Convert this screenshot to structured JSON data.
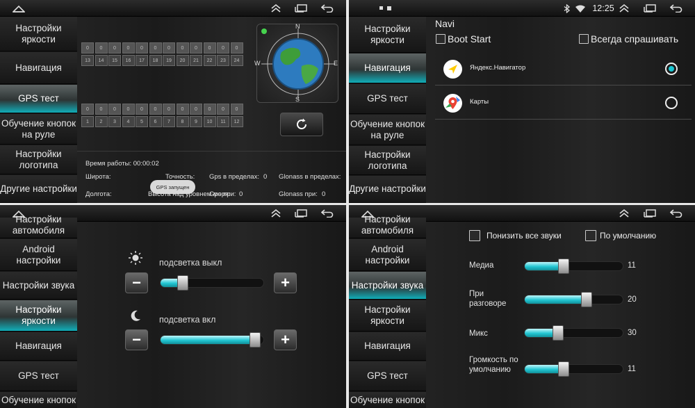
{
  "panels": {
    "gps": {
      "clock": "",
      "sidebar": [
        "Настройки яркости",
        "Навигация",
        "GPS тест",
        "Обучение кнопок на руле",
        "Настройки логотипа",
        "Другие настройки"
      ],
      "active_index": 2,
      "satellites_top_values": [
        "0",
        "0",
        "0",
        "0",
        "0",
        "0",
        "0",
        "0",
        "0",
        "0",
        "0",
        "0"
      ],
      "satellites_top_ids": [
        "13",
        "14",
        "15",
        "16",
        "17",
        "18",
        "19",
        "20",
        "21",
        "22",
        "23",
        "24"
      ],
      "satellites_bottom_values": [
        "0",
        "0",
        "0",
        "0",
        "0",
        "0",
        "0",
        "0",
        "0",
        "0",
        "0",
        "0"
      ],
      "satellites_bottom_ids": [
        "1",
        "2",
        "3",
        "4",
        "5",
        "6",
        "7",
        "8",
        "9",
        "10",
        "11",
        "12"
      ],
      "compass": {
        "n": "N",
        "s": "S",
        "e": "E",
        "w": "W"
      },
      "uptime": "Время работы: 00:00:02",
      "latitude": "Широта:",
      "longitude": "Долгота:",
      "accuracy": "Точность:",
      "altitude": "Высота над уровнем моря:",
      "gps_in_range": "Gps в пределах:",
      "gps_in_range_value": "0",
      "glonass_in_range": "Glonass в пределах:",
      "glonass_in_range_value": "0",
      "gps_when": "Gps при:",
      "gps_when_value": "0",
      "glonass_when": "Glonass при:",
      "glonass_when_value": "0",
      "toast": "GPS запущен"
    },
    "navi": {
      "clock": "12:25",
      "sidebar": [
        "Настройки яркости",
        "Навигация",
        "GPS тест",
        "Обучение кнопок на руле",
        "Настройки логотипа",
        "Другие настройки"
      ],
      "active_index": 1,
      "title": "Navi",
      "boot_start": "Boot Start",
      "always_ask": "Всегда спрашивать",
      "apps": [
        {
          "label": "Яндекс.Навигатор",
          "selected": true
        },
        {
          "label": "Карты",
          "selected": false
        }
      ]
    },
    "brightness": {
      "sidebar": [
        "Настройки автомобиля",
        "Android настройки",
        "Настройки звука",
        "Настройки яркости",
        "Навигация",
        "GPS тест",
        "Обучение кнопок"
      ],
      "active_index": 3,
      "backlight_off": {
        "label": "подсветка выкл",
        "level": 0.18
      },
      "backlight_on": {
        "label": "подсветка вкл",
        "level": 0.97
      },
      "minus": "−",
      "plus": "+"
    },
    "sound": {
      "sidebar": [
        "Настройки автомобиля",
        "Android настройки",
        "Настройки звука",
        "Настройки яркости",
        "Навигация",
        "GPS тест",
        "Обучение кнопок"
      ],
      "active_index": 2,
      "lower_all": "Понизить все звуки",
      "default": "По умолчанию",
      "volumes": [
        {
          "label": "Медиа",
          "value": "11",
          "level": 0.38
        },
        {
          "label": "При разговоре",
          "value": "20",
          "level": 0.65
        },
        {
          "label": "Микс",
          "value": "30",
          "level": 0.32
        },
        {
          "label": "Громкость по умолчанию",
          "value": "11",
          "level": 0.38
        }
      ]
    }
  },
  "colors": {
    "accent": "#19c6d2",
    "background": "#1c1c1c",
    "sidebar_active_bottom": "#11adb8"
  },
  "icons": [
    "home-icon",
    "recent-apps-icon",
    "collapse-icon",
    "back-icon",
    "bluetooth-icon",
    "wifi-icon",
    "sun-icon",
    "moon-icon",
    "refresh-icon",
    "compass-globe-icon",
    "yandex-navigator-icon",
    "google-maps-icon"
  ]
}
